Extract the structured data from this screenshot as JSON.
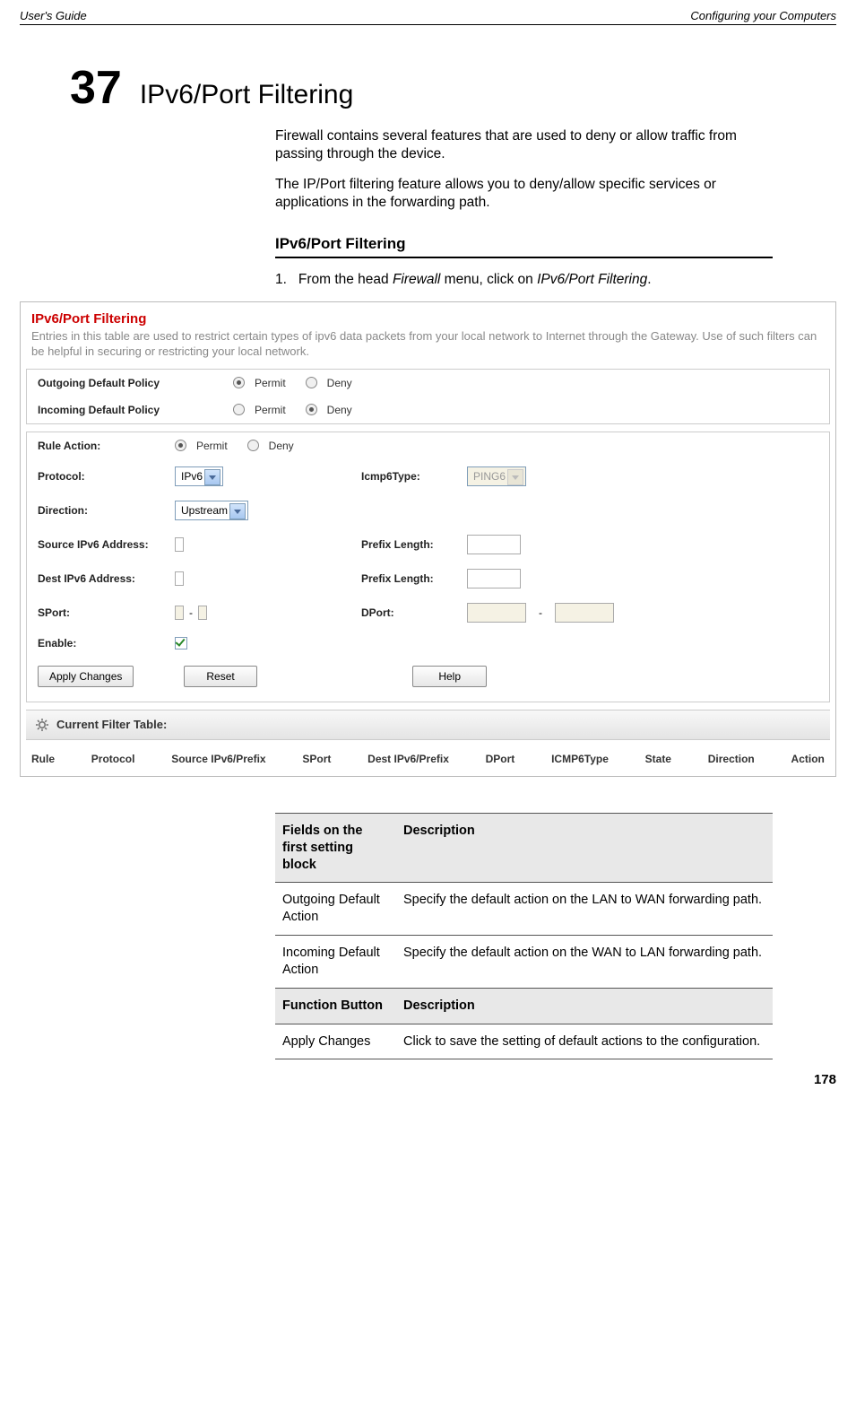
{
  "header": {
    "left": "User's Guide",
    "right": "Configuring your Computers"
  },
  "chapter": {
    "num": "37",
    "title": "IPv6/Port Filtering"
  },
  "intro": {
    "p1": "Firewall contains several features that are used to deny or allow traffic from passing through the device.",
    "p2": "The IP/Port filtering feature allows you to deny/allow specific services or applications in the forwarding path."
  },
  "section": {
    "title": "IPv6/Port Filtering"
  },
  "step": {
    "num": "1.",
    "pre": "From the head ",
    "it1": "Firewall",
    "mid": " menu, click on ",
    "it2": "IPv6/Port Filtering",
    "post": "."
  },
  "ss": {
    "title": "IPv6/Port Filtering",
    "desc": "Entries in this table are used to restrict certain types of ipv6 data packets from your local network to Internet through the Gateway. Use of such filters can be helpful in securing or restricting your local network.",
    "outgoing_label": "Outgoing Default Policy",
    "incoming_label": "Incoming Default Policy",
    "permit": "Permit",
    "deny": "Deny",
    "rule_action": "Rule Action:",
    "protocol": "Protocol:",
    "protocol_val": "IPv6",
    "icmp6type": "Icmp6Type:",
    "icmp6_hint": "PING6",
    "direction": "Direction:",
    "direction_val": "Upstream",
    "src_addr": "Source IPv6 Address:",
    "dst_addr": "Dest IPv6 Address:",
    "prefix_len": "Prefix Length:",
    "sport": "SPort:",
    "dport": "DPort:",
    "dash": "-",
    "enable": "Enable:",
    "apply": "Apply Changes",
    "reset": "Reset",
    "help": "Help",
    "cft_title": "Current Filter Table:",
    "cols": {
      "rule": "Rule",
      "protocol": "Protocol",
      "src": "Source IPv6/Prefix",
      "sport": "SPort",
      "dst": "Dest IPv6/Prefix",
      "dport": "DPort",
      "icmp": "ICMP6Type",
      "state": "State",
      "direction": "Direction",
      "action": "Action"
    }
  },
  "table": {
    "h1": "Fields on the first setting block",
    "h2": "Description",
    "r1c1": "Outgoing Default Action",
    "r1c2": "Specify the default action on the LAN to WAN forwarding path.",
    "r2c1": "Incoming Default Action",
    "r2c2": "Specify the default action on the WAN to LAN forwarding path.",
    "h3": "Function Button",
    "h4": "Description",
    "r3c1": "Apply Changes",
    "r3c2": "Click to save the setting of default actions to the configuration."
  },
  "page_num": "178"
}
